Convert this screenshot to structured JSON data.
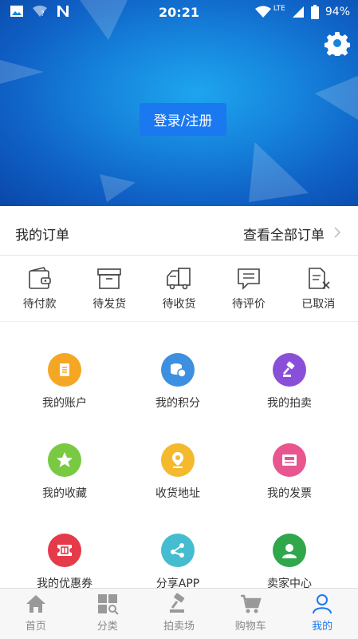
{
  "status_bar": {
    "time": "20:21",
    "network_label": "LTE",
    "battery": "94%",
    "left_icons": [
      "image-icon",
      "wifi-question-icon",
      "n-app-icon"
    ],
    "right_icons": [
      "wifi-icon",
      "signal-icon",
      "battery-icon"
    ]
  },
  "header": {
    "login_label": "登录/注册",
    "settings_icon": "gear-icon",
    "background_color": "#1684dc"
  },
  "orders": {
    "title": "我的订单",
    "view_all": "查看全部订单",
    "items": [
      {
        "label": "待付款",
        "icon": "wallet-icon"
      },
      {
        "label": "待发货",
        "icon": "box-icon"
      },
      {
        "label": "待收货",
        "icon": "truck-icon"
      },
      {
        "label": "待评价",
        "icon": "comment-icon"
      },
      {
        "label": "已取消",
        "icon": "cancel-doc-icon"
      }
    ]
  },
  "menu": [
    {
      "label": "我的账户",
      "icon": "account-icon",
      "color": "#f5a623"
    },
    {
      "label": "我的积分",
      "icon": "points-icon",
      "color": "#3d8fe0"
    },
    {
      "label": "我的拍卖",
      "icon": "auction-icon",
      "color": "#8a4fd8"
    },
    {
      "label": "我的收藏",
      "icon": "star-icon",
      "color": "#7ac943"
    },
    {
      "label": "收货地址",
      "icon": "location-icon",
      "color": "#f5b92e"
    },
    {
      "label": "我的发票",
      "icon": "invoice-icon",
      "color": "#e9558f"
    },
    {
      "label": "我的优惠券",
      "icon": "coupon-icon",
      "color": "#e53a4a"
    },
    {
      "label": "分享APP",
      "icon": "share-icon",
      "color": "#45bcd0"
    },
    {
      "label": "卖家中心",
      "icon": "seller-icon",
      "color": "#2fa74a"
    }
  ],
  "tabbar": {
    "active_color": "#1a78f0",
    "items": [
      {
        "label": "首页",
        "icon": "home-icon"
      },
      {
        "label": "分类",
        "icon": "category-icon"
      },
      {
        "label": "拍卖场",
        "icon": "gavel-icon"
      },
      {
        "label": "购物车",
        "icon": "cart-icon"
      },
      {
        "label": "我的",
        "icon": "profile-icon"
      }
    ]
  }
}
